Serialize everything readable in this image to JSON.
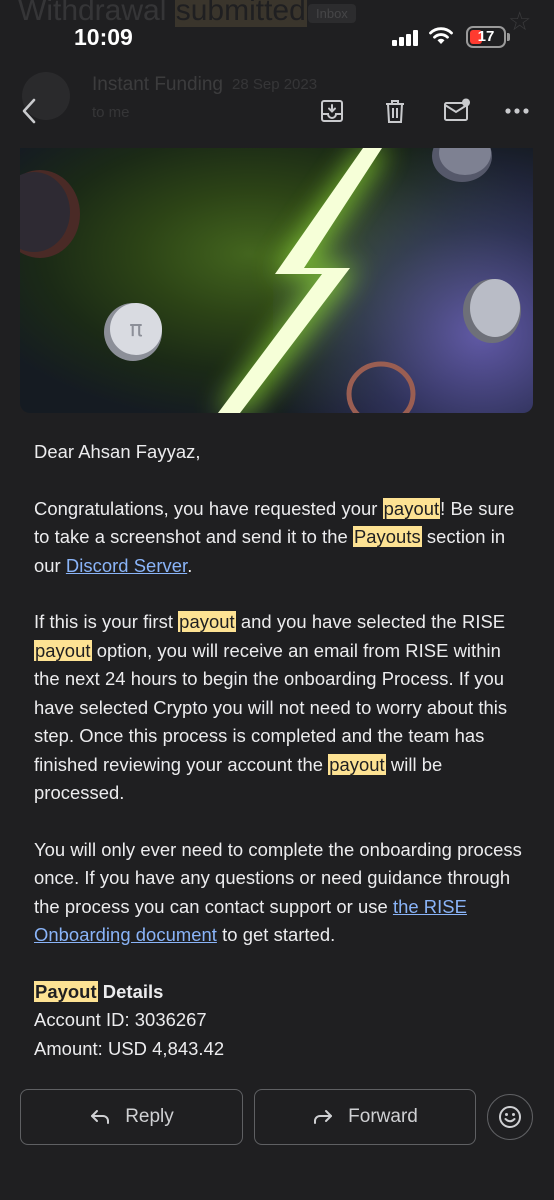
{
  "status_bar": {
    "time": "10:09",
    "battery": "17"
  },
  "ghost_header": {
    "subject_prefix": "Withdrawal ",
    "subject_highlight": "submitted",
    "label": "Inbox",
    "sender": "Instant Funding",
    "date": "28 Sep 2023",
    "to": "to me"
  },
  "toolbar": {
    "back_icon": "chevron-left-icon",
    "archive_icon": "archive-icon",
    "delete_icon": "trash-icon",
    "mark_unread_icon": "mail-unread-icon",
    "more_icon": "more-horizontal-icon"
  },
  "email": {
    "greeting": "Dear Ahsan Fayyaz,",
    "p1": {
      "a": "Congratulations, you have requested your ",
      "hl1": "payout",
      "b": "! Be sure to take a screenshot and send it to the ",
      "hl2": "Payouts",
      "c": " section in our ",
      "link": "Discord Server",
      "d": "."
    },
    "p2": {
      "a": "If this is your first ",
      "hl1": "payout",
      "b": " and you have selected the RISE ",
      "hl2": "payout",
      "c": " option, you will receive an email from RISE within the next 24 hours to begin the onboarding Process. If you have selected Crypto you will not need to worry about this step. Once this process is completed and the team has finished reviewing your account the ",
      "hl3": "payout",
      "d": " will be processed."
    },
    "p3": {
      "a": "You will only ever need to complete the onboarding process once. If you have any questions or need guidance through the process you can contact support or use ",
      "link": "the RISE Onboarding document",
      "b": " to get started."
    },
    "details": {
      "hl": "Payout",
      "title_rest": " Details",
      "account": "Account ID: 3036267",
      "amount": "Amount: USD 4,843.42"
    }
  },
  "actions": {
    "reply_label": "Reply",
    "forward_label": "Forward",
    "emoji_icon": "smiley-icon"
  },
  "colors": {
    "background": "#1f1f21",
    "highlight": "#fde293",
    "link": "#8ab4f8",
    "battery_low": "#ff3b30"
  }
}
